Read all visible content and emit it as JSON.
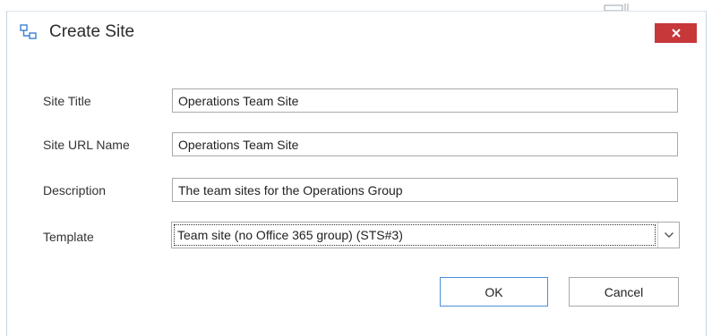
{
  "dialog": {
    "title": "Create Site",
    "close_label": "×"
  },
  "form": {
    "site_title": {
      "label": "Site Title",
      "value": "Operations Team Site"
    },
    "site_url_name": {
      "label": "Site URL Name",
      "value": "Operations Team Site"
    },
    "description": {
      "label": "Description",
      "value": "The team sites for the Operations Group"
    },
    "template": {
      "label": "Template",
      "selected": "Team site (no Office 365 group) (STS#3)"
    }
  },
  "buttons": {
    "ok_label": "OK",
    "cancel_label": "Cancel"
  },
  "icons": {
    "title": "create-site-icon",
    "close": "close-icon",
    "dropdown": "chevron-down-icon"
  },
  "colors": {
    "close_button": "#c7383b",
    "ok_border": "#4a8fd8",
    "icon_blue": "#3d7fd1"
  }
}
